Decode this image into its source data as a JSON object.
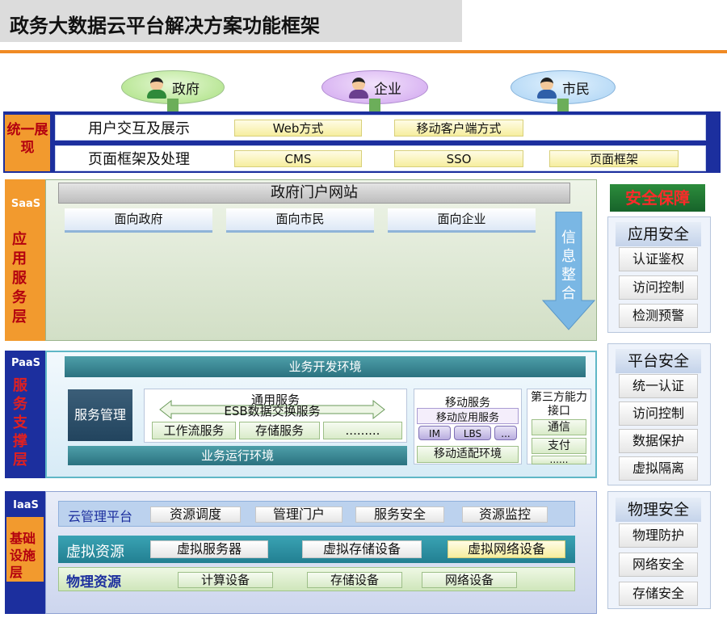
{
  "title": "政务大数据云平台解决方案功能框架",
  "users": [
    {
      "label": "政府",
      "color": "#a9e07f"
    },
    {
      "label": "企业",
      "color": "#d0a4ef"
    },
    {
      "label": "市民",
      "color": "#a9d2f4"
    }
  ],
  "presentation": {
    "side_label": "统一展现",
    "row1": {
      "label": "用户交互及展示",
      "items": [
        "Web方式",
        "移动客户端方式"
      ]
    },
    "row2": {
      "label": "页面框架及处理",
      "items": [
        "CMS",
        "SSO",
        "页面框架"
      ]
    }
  },
  "saas": {
    "tag": "SaaS",
    "side_label": "应用服务层",
    "portal": "政府门户网站",
    "faces": [
      "面向政府",
      "面向市民",
      "面向企业"
    ],
    "integration": "信息整合"
  },
  "paas": {
    "tag": "PaaS",
    "side_label": "服务支撑层",
    "dev_env": "业务开发环境",
    "service_mgmt": "服务管理",
    "general_service": "通用服务",
    "esb": "ESB数据交换服务",
    "general_items": [
      "工作流服务",
      "存储服务",
      "........."
    ],
    "mobile_service": "移动服务",
    "mobile_app_service": "移动应用服务",
    "mobile_pills": [
      "IM",
      "LBS",
      "..."
    ],
    "mobile_adapt": "移动适配环境",
    "third_party": "第三方能力接口",
    "third_items": [
      "通信",
      "支付",
      "......"
    ],
    "runtime_env": "业务运行环境"
  },
  "iaas": {
    "tag": "IaaS",
    "side_label": "基础设施层",
    "cloud_mgmt": {
      "label": "云管理平台",
      "items": [
        "资源调度",
        "管理门户",
        "服务安全",
        "资源监控"
      ]
    },
    "virtual": {
      "label": "虚拟资源",
      "items": [
        "虚拟服务器",
        "虚拟存储设备",
        "虚拟网络设备"
      ]
    },
    "physical": {
      "label": "物理资源",
      "items": [
        "计算设备",
        "存储设备",
        "网络设备"
      ]
    }
  },
  "security": {
    "title": "安全保障",
    "groups": [
      {
        "head": "应用安全",
        "items": [
          "认证鉴权",
          "访问控制",
          "检测预警"
        ]
      },
      {
        "head": "平台安全",
        "items": [
          "统一认证",
          "访问控制",
          "数据保护",
          "虚拟隔离"
        ]
      },
      {
        "head": "物理安全",
        "items": [
          "物理防护",
          "网络安全",
          "存储安全"
        ]
      }
    ]
  },
  "colors": {
    "accent_orange": "#f08a24",
    "layer_blue": "#1c2f9e",
    "label_red": "#b3000f",
    "security_green": "#1f7a2e"
  }
}
